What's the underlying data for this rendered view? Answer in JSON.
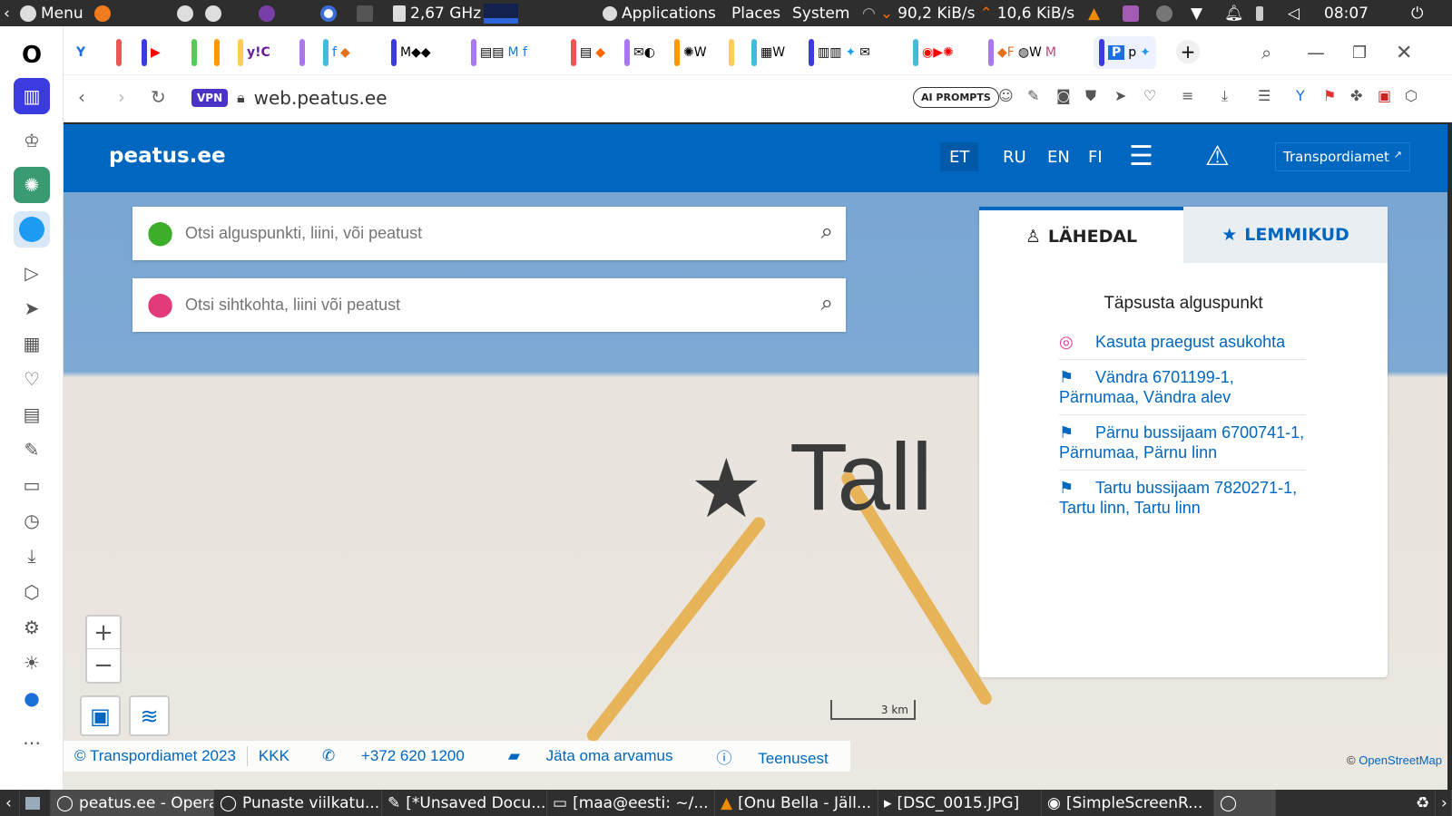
{
  "os_top": {
    "menu": "Menu",
    "cpu": "2,67 GHz",
    "applications": "Applications",
    "places": "Places",
    "system": "System",
    "net_down": "90,2 KiB/s",
    "net_up": "10,6 KiB/s",
    "clock": "08:07"
  },
  "browser": {
    "vpn_label": "VPN",
    "url_host": "web.peatus.ee",
    "ai_prompts": "AI PROMPTS"
  },
  "site": {
    "logo": "peatus.ee",
    "langs": [
      "ET",
      "RU",
      "EN",
      "FI"
    ],
    "active_lang": "ET",
    "transport_link": "Transpordiamet"
  },
  "search": {
    "from_placeholder": "Otsi alguspunkti, liini, või peatust",
    "to_placeholder": "Otsi sihtkohta, liini või peatust"
  },
  "panel": {
    "tab_nearby": "LÄHEDAL",
    "tab_favourites": "LEMMIKUD",
    "title": "Täpsusta alguspunkt",
    "items": [
      "Kasuta praegust asukohta",
      "Vändra 6701199-1, Pärnumaa, Vändra alev",
      "Pärnu bussijaam 6700741-1, Pärnumaa, Pärnu linn",
      "Tartu bussijaam 7820271-1, Tartu linn, Tartu linn"
    ]
  },
  "map": {
    "city_label": "Tall",
    "scale": "3 km",
    "attribution_prefix": "©",
    "attribution_link": "OpenStreetMap"
  },
  "footer": {
    "copyright": "© Transpordiamet 2023",
    "kkk": "KKK",
    "phone": "+372 620 1200",
    "feedback": "Jäta oma arvamus",
    "service": "Teenusest"
  },
  "taskbar": {
    "tasks": [
      "peatus.ee - Opera",
      "Punaste viilkatu...",
      "[*Unsaved Docu...",
      "[maa@eesti: ~/...",
      "[Onu Bella - Jäll...",
      "[DSC_0015.JPG]",
      "[SimpleScreenR..."
    ]
  }
}
